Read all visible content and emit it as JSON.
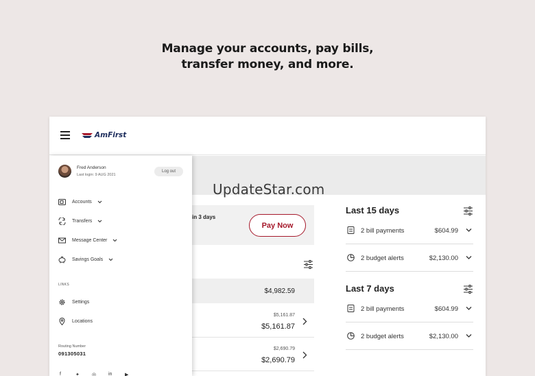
{
  "headline": {
    "line1": "Manage your accounts, pay bills,",
    "line2": "transfer money, and more."
  },
  "brand": {
    "logo_text": "AmFirst",
    "accent": "#a5182a",
    "navy": "#1d2d5c"
  },
  "drawer": {
    "user_name": "Fred Anderson",
    "last_login": "Last login: 9 AUG 2021",
    "logout_label": "Log out",
    "nav": [
      {
        "label": "Accounts",
        "icon": "wallet-icon"
      },
      {
        "label": "Transfers",
        "icon": "transfer-icon"
      },
      {
        "label": "Message Center",
        "icon": "mail-icon"
      },
      {
        "label": "Savings Goals",
        "icon": "piggy-bank-icon"
      }
    ],
    "links_label": "LINKS",
    "links": [
      {
        "label": "Settings",
        "icon": "gear-icon"
      },
      {
        "label": "Locations",
        "icon": "location-pin-icon"
      }
    ],
    "routing_label": "Routing Number",
    "routing_number": "091305031",
    "social": [
      "facebook-icon",
      "twitter-icon",
      "instagram-icon",
      "linkedin-icon",
      "youtube-icon"
    ]
  },
  "main": {
    "due_text": "in 3 days",
    "pay_now_label": "Pay Now",
    "accounts_total": "$4,982.59",
    "accounts": [
      {
        "small": "$5,161.87",
        "big": "$5,161.87"
      },
      {
        "small": "$2,690.79",
        "big": "$2,690.79"
      }
    ]
  },
  "sections": [
    {
      "title": "Last 15 days",
      "rows": [
        {
          "label": "2 bill payments",
          "value": "$604.99",
          "icon": "receipt-icon"
        },
        {
          "label": "2 budget alerts",
          "value": "$2,130.00",
          "icon": "pie-chart-icon"
        }
      ]
    },
    {
      "title": "Last 7 days",
      "rows": [
        {
          "label": "2 bill payments",
          "value": "$604.99",
          "icon": "receipt-icon"
        },
        {
          "label": "2 budget alerts",
          "value": "$2,130.00",
          "icon": "pie-chart-icon"
        }
      ]
    }
  ],
  "watermark": "UpdateStar.com"
}
